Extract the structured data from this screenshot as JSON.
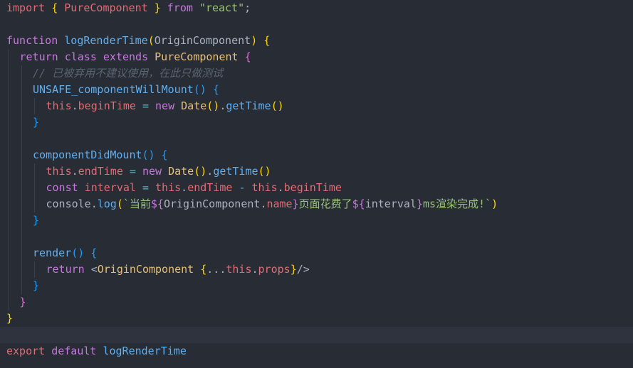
{
  "editor": {
    "language": "javascript",
    "background": "#282c34",
    "current_line_index": 20,
    "lines": [
      {
        "indent": 0,
        "tokens": [
          {
            "t": "import",
            "c": "kw2"
          },
          {
            "t": " ",
            "c": "pl"
          },
          {
            "t": "{",
            "c": "br1"
          },
          {
            "t": " ",
            "c": "pl"
          },
          {
            "t": "PureComponent",
            "c": "prop"
          },
          {
            "t": " ",
            "c": "pl"
          },
          {
            "t": "}",
            "c": "br1"
          },
          {
            "t": " ",
            "c": "pl"
          },
          {
            "t": "from",
            "c": "kw"
          },
          {
            "t": " ",
            "c": "pl"
          },
          {
            "t": "\"react\"",
            "c": "str"
          },
          {
            "t": ";",
            "c": "pl"
          }
        ]
      },
      {
        "indent": 0,
        "tokens": []
      },
      {
        "indent": 0,
        "tokens": [
          {
            "t": "function",
            "c": "kw"
          },
          {
            "t": " ",
            "c": "pl"
          },
          {
            "t": "logRenderTime",
            "c": "fn"
          },
          {
            "t": "(",
            "c": "br1"
          },
          {
            "t": "OriginComponent",
            "c": "pl"
          },
          {
            "t": ")",
            "c": "br1"
          },
          {
            "t": " ",
            "c": "pl"
          },
          {
            "t": "{",
            "c": "br1"
          }
        ]
      },
      {
        "indent": 1,
        "tokens": [
          {
            "t": "return",
            "c": "kw"
          },
          {
            "t": " ",
            "c": "pl"
          },
          {
            "t": "class",
            "c": "kw"
          },
          {
            "t": " ",
            "c": "pl"
          },
          {
            "t": "extends",
            "c": "kw"
          },
          {
            "t": " ",
            "c": "pl"
          },
          {
            "t": "PureComponent",
            "c": "cls"
          },
          {
            "t": " ",
            "c": "pl"
          },
          {
            "t": "{",
            "c": "br2"
          }
        ]
      },
      {
        "indent": 2,
        "tokens": [
          {
            "t": "// 已被弃用不建议使用，在此只做测试",
            "c": "cm"
          }
        ]
      },
      {
        "indent": 2,
        "tokens": [
          {
            "t": "UNSAFE_componentWillMount",
            "c": "fn"
          },
          {
            "t": "()",
            "c": "br3"
          },
          {
            "t": " ",
            "c": "pl"
          },
          {
            "t": "{",
            "c": "br3"
          }
        ]
      },
      {
        "indent": 3,
        "tokens": [
          {
            "t": "this",
            "c": "this"
          },
          {
            "t": ".",
            "c": "pl"
          },
          {
            "t": "beginTime",
            "c": "prop"
          },
          {
            "t": " ",
            "c": "pl"
          },
          {
            "t": "=",
            "c": "op"
          },
          {
            "t": " ",
            "c": "pl"
          },
          {
            "t": "new",
            "c": "kw"
          },
          {
            "t": " ",
            "c": "pl"
          },
          {
            "t": "Date",
            "c": "cls"
          },
          {
            "t": "()",
            "c": "br1"
          },
          {
            "t": ".",
            "c": "pl"
          },
          {
            "t": "getTime",
            "c": "fn"
          },
          {
            "t": "()",
            "c": "br1"
          }
        ]
      },
      {
        "indent": 2,
        "tokens": [
          {
            "t": "}",
            "c": "br3"
          }
        ]
      },
      {
        "indent": 2,
        "tokens": []
      },
      {
        "indent": 2,
        "tokens": [
          {
            "t": "componentDidMount",
            "c": "fn"
          },
          {
            "t": "()",
            "c": "br3"
          },
          {
            "t": " ",
            "c": "pl"
          },
          {
            "t": "{",
            "c": "br3"
          }
        ]
      },
      {
        "indent": 3,
        "tokens": [
          {
            "t": "this",
            "c": "this"
          },
          {
            "t": ".",
            "c": "pl"
          },
          {
            "t": "endTime",
            "c": "prop"
          },
          {
            "t": " ",
            "c": "pl"
          },
          {
            "t": "=",
            "c": "op"
          },
          {
            "t": " ",
            "c": "pl"
          },
          {
            "t": "new",
            "c": "kw"
          },
          {
            "t": " ",
            "c": "pl"
          },
          {
            "t": "Date",
            "c": "cls"
          },
          {
            "t": "()",
            "c": "br1"
          },
          {
            "t": ".",
            "c": "pl"
          },
          {
            "t": "getTime",
            "c": "fn"
          },
          {
            "t": "()",
            "c": "br1"
          }
        ]
      },
      {
        "indent": 3,
        "tokens": [
          {
            "t": "const",
            "c": "kw"
          },
          {
            "t": " ",
            "c": "pl"
          },
          {
            "t": "interval",
            "c": "prop"
          },
          {
            "t": " ",
            "c": "pl"
          },
          {
            "t": "=",
            "c": "op"
          },
          {
            "t": " ",
            "c": "pl"
          },
          {
            "t": "this",
            "c": "this"
          },
          {
            "t": ".",
            "c": "pl"
          },
          {
            "t": "endTime",
            "c": "prop"
          },
          {
            "t": " ",
            "c": "pl"
          },
          {
            "t": "-",
            "c": "op"
          },
          {
            "t": " ",
            "c": "pl"
          },
          {
            "t": "this",
            "c": "this"
          },
          {
            "t": ".",
            "c": "pl"
          },
          {
            "t": "beginTime",
            "c": "prop"
          }
        ]
      },
      {
        "indent": 3,
        "tokens": [
          {
            "t": "console",
            "c": "pl"
          },
          {
            "t": ".",
            "c": "pl"
          },
          {
            "t": "log",
            "c": "fn"
          },
          {
            "t": "(",
            "c": "br1"
          },
          {
            "t": "`当前",
            "c": "str"
          },
          {
            "t": "${",
            "c": "tpl"
          },
          {
            "t": "OriginComponent",
            "c": "pl"
          },
          {
            "t": ".",
            "c": "pl"
          },
          {
            "t": "name",
            "c": "prop"
          },
          {
            "t": "}",
            "c": "tpl"
          },
          {
            "t": "页面花费了",
            "c": "str"
          },
          {
            "t": "${",
            "c": "tpl"
          },
          {
            "t": "interval",
            "c": "pl"
          },
          {
            "t": "}",
            "c": "tpl"
          },
          {
            "t": "ms渲染完成!`",
            "c": "str"
          },
          {
            "t": ")",
            "c": "br1"
          }
        ]
      },
      {
        "indent": 2,
        "tokens": [
          {
            "t": "}",
            "c": "br3"
          }
        ]
      },
      {
        "indent": 2,
        "tokens": []
      },
      {
        "indent": 2,
        "tokens": [
          {
            "t": "render",
            "c": "fn"
          },
          {
            "t": "()",
            "c": "br3"
          },
          {
            "t": " ",
            "c": "pl"
          },
          {
            "t": "{",
            "c": "br3"
          }
        ]
      },
      {
        "indent": 3,
        "tokens": [
          {
            "t": "return",
            "c": "kw"
          },
          {
            "t": " ",
            "c": "pl"
          },
          {
            "t": "<",
            "c": "pl"
          },
          {
            "t": "OriginComponent",
            "c": "cls"
          },
          {
            "t": " ",
            "c": "pl"
          },
          {
            "t": "{",
            "c": "br1"
          },
          {
            "t": "...",
            "c": "pl"
          },
          {
            "t": "this",
            "c": "this"
          },
          {
            "t": ".",
            "c": "pl"
          },
          {
            "t": "props",
            "c": "prop"
          },
          {
            "t": "}",
            "c": "br1"
          },
          {
            "t": "/>",
            "c": "pl"
          }
        ]
      },
      {
        "indent": 2,
        "tokens": [
          {
            "t": "}",
            "c": "br3"
          }
        ]
      },
      {
        "indent": 1,
        "tokens": [
          {
            "t": "}",
            "c": "br2"
          }
        ]
      },
      {
        "indent": 0,
        "tokens": [
          {
            "t": "}",
            "c": "br1"
          }
        ]
      },
      {
        "indent": 0,
        "tokens": []
      },
      {
        "indent": 0,
        "tokens": [
          {
            "t": "export",
            "c": "kw2"
          },
          {
            "t": " ",
            "c": "pl"
          },
          {
            "t": "default",
            "c": "kw"
          },
          {
            "t": " ",
            "c": "pl"
          },
          {
            "t": "logRenderTime",
            "c": "fn"
          }
        ]
      }
    ]
  }
}
